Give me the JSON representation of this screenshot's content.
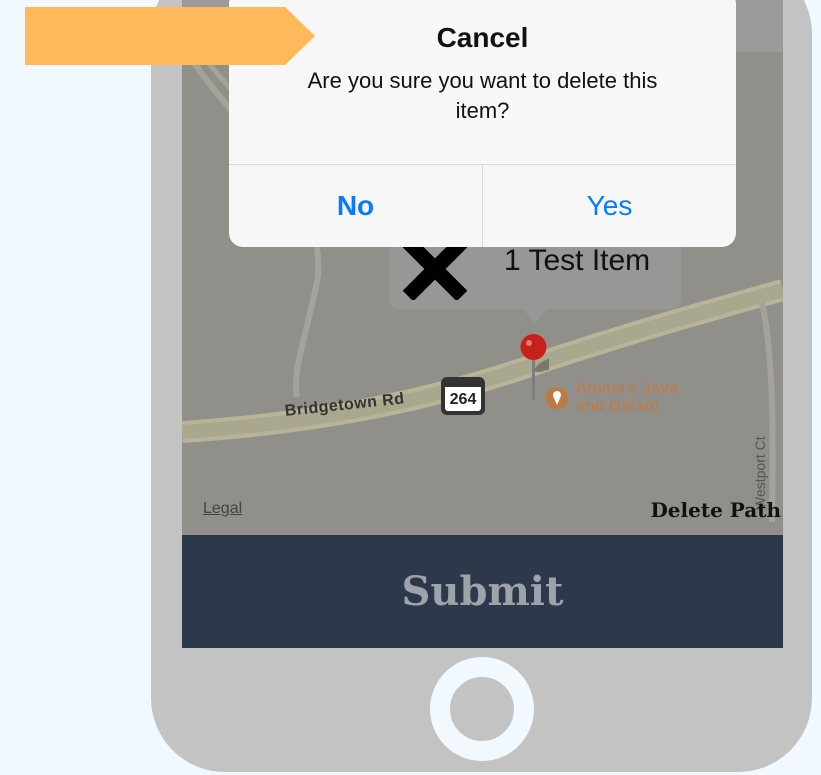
{
  "alert": {
    "title": "Cancel",
    "message": "Are you sure you want to delete this item?",
    "no_label": "No",
    "yes_label": "Yes"
  },
  "callout": {
    "title": "1 Test Item",
    "icon": "x-mark-icon"
  },
  "map": {
    "road_label": "Bridgetown Rd",
    "route_number": "264",
    "poi_label_line1": "Aroma's Java",
    "poi_label_line2": "and Gelato",
    "street_label": "Westport Ct",
    "legal_label": "Legal"
  },
  "actions": {
    "delete_path_label": "Delete Path",
    "submit_label": "Submit"
  },
  "colors": {
    "arrow": "#ffb95a",
    "alert_button": "#0a7aff",
    "submit_bar": "#2d394b",
    "pin": "#c8201c",
    "poi": "#c07a3f"
  }
}
